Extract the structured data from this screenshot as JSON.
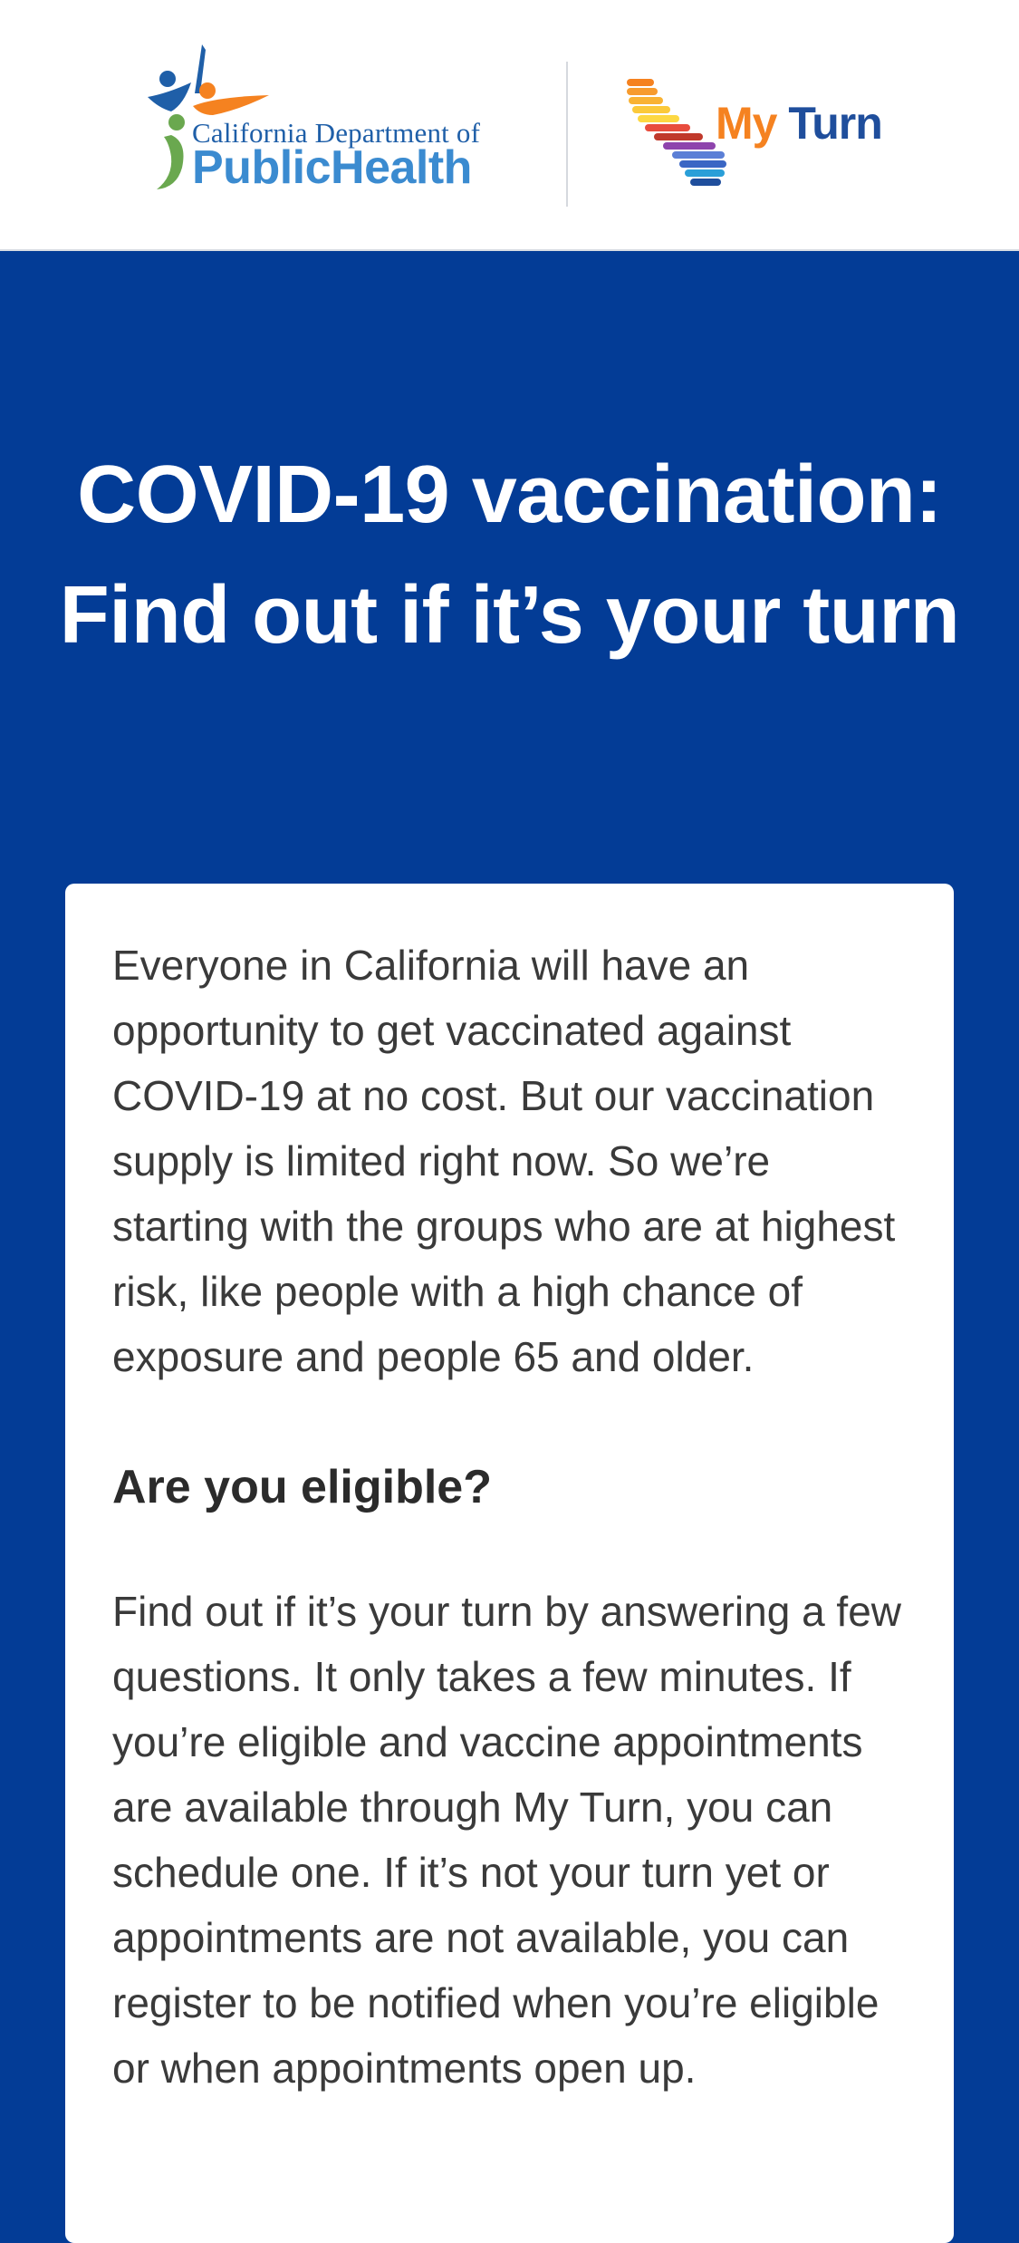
{
  "header": {
    "cdph_logo_line1": "California Department of",
    "cdph_logo_line2": "PublicHealth",
    "myturn_logo_my": "My",
    "myturn_logo_turn": "Turn"
  },
  "hero": {
    "title": "COVID-19 vaccination: Find out if it’s your turn"
  },
  "card": {
    "intro": "Everyone in California will have an opportunity to get vaccinated against COVID-19 at no cost. But our vaccination supply is limited right now. So we’re starting with the groups who are at highest risk, like people with a high chance of exposure and people 65 and older.",
    "eligibility_heading": "Are you eligible?",
    "eligibility_text": "Find out if it’s your turn by answering a few questions. It only takes a few minutes. If you’re eligible and vaccine appointments are available through My Turn, you can schedule one. If it’s not your turn yet or appointments are not available, you can register to be notified when you’re eligible or when appointments open up."
  },
  "colors": {
    "background": "#033c96",
    "card": "#ffffff",
    "myturn_orange": "#f58220",
    "myturn_blue": "#1f4e9c",
    "cdph_blue": "#3b8bd0"
  }
}
